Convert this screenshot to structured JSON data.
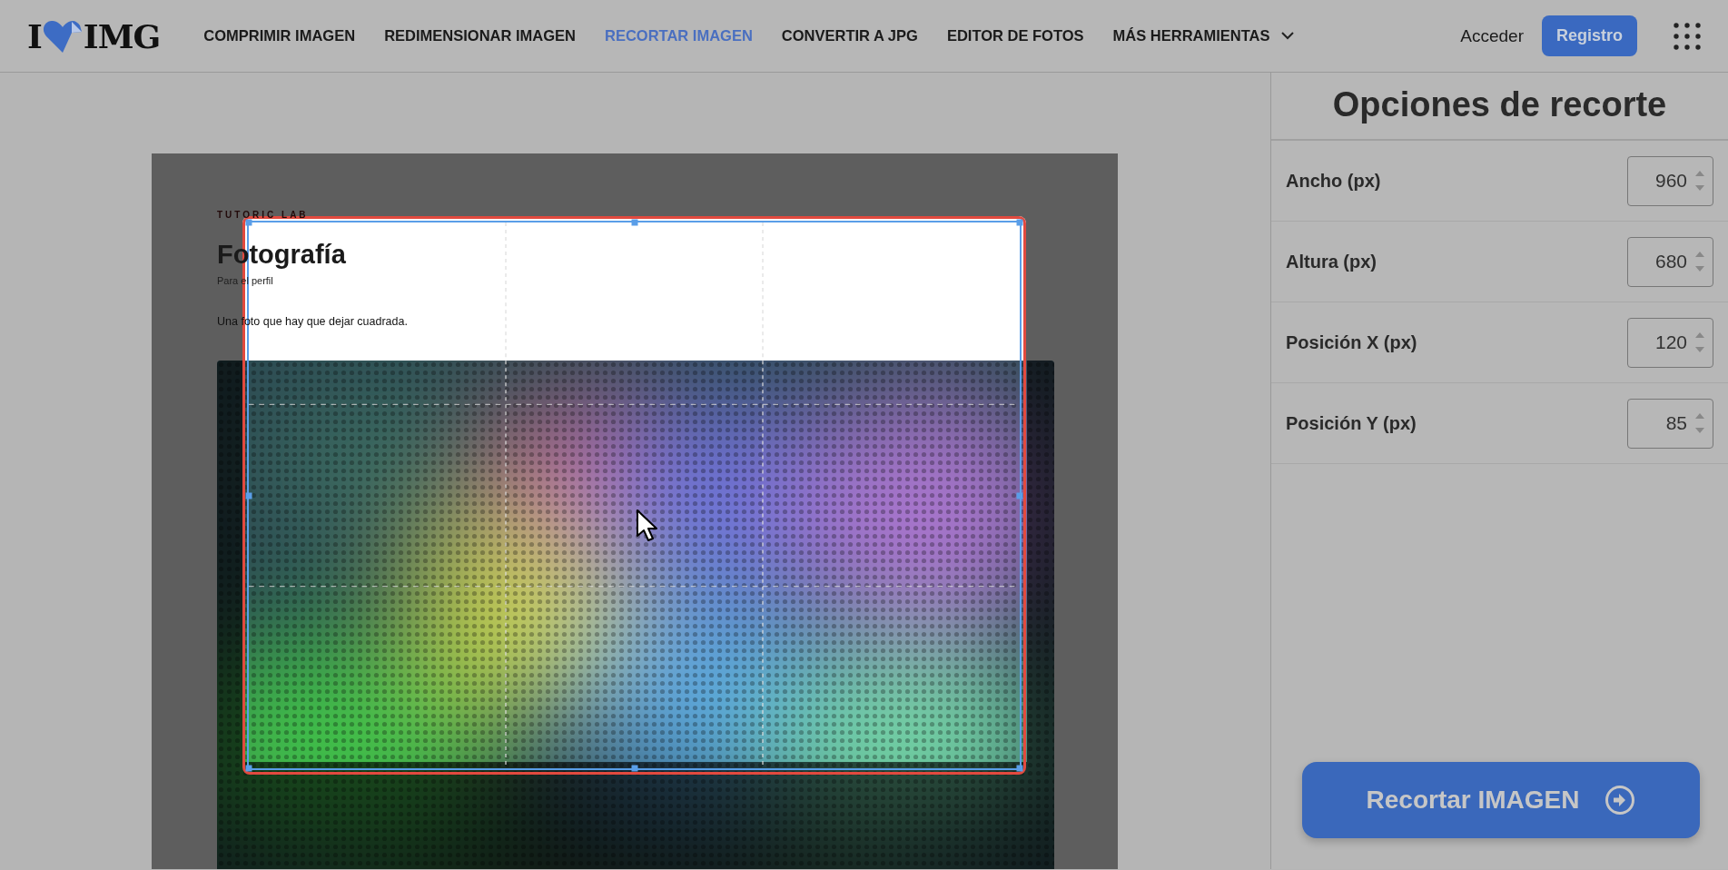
{
  "header": {
    "logo": {
      "left": "I",
      "right": "IMG"
    },
    "nav": [
      {
        "label": "COMPRIMIR IMAGEN",
        "selected": false
      },
      {
        "label": "REDIMENSIONAR IMAGEN",
        "selected": false
      },
      {
        "label": "RECORTAR IMAGEN",
        "selected": true
      },
      {
        "label": "CONVERTIR A JPG",
        "selected": false
      },
      {
        "label": "EDITOR DE FOTOS",
        "selected": false
      }
    ],
    "more_menu": "MÁS HERRAMIENTAS",
    "login": "Acceder",
    "register": "Registro"
  },
  "document": {
    "eyebrow": "TUTORIC LAB",
    "title": "Fotografía",
    "subtitle": "Para el perfil",
    "body": "Una foto que hay que dejar cuadrada."
  },
  "panel": {
    "title": "Opciones de recorte",
    "fields": [
      {
        "label": "Ancho (px)",
        "value": "960"
      },
      {
        "label": "Altura (px)",
        "value": "680"
      },
      {
        "label": "Posición X (px)",
        "value": "120"
      },
      {
        "label": "Posición Y (px)",
        "value": "85"
      }
    ],
    "action": "Recortar IMAGEN"
  }
}
